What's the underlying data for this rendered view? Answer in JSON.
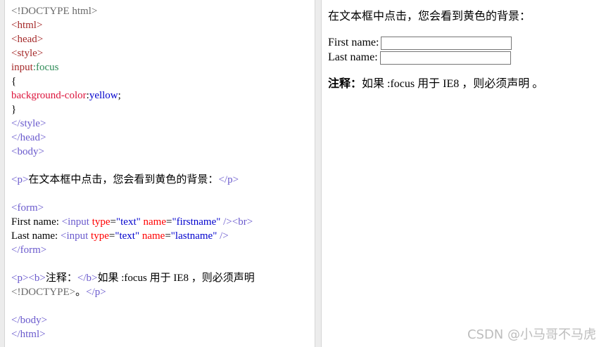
{
  "code_editor": {
    "lines": [
      [
        {
          "t": "<!DOCTYPE html>",
          "c": "c-doc"
        }
      ],
      [
        {
          "t": "<html>",
          "c": "c-tag"
        }
      ],
      [
        {
          "t": "<head>",
          "c": "c-tag"
        }
      ],
      [
        {
          "t": "<style>",
          "c": "c-tag"
        }
      ],
      [
        {
          "t": "input",
          "c": "c-sel"
        },
        {
          "t": ":focus",
          "c": "c-pseudo"
        }
      ],
      [
        {
          "t": "{",
          "c": "c-txt"
        }
      ],
      [
        {
          "t": "background-color",
          "c": "c-prop"
        },
        {
          "t": ":",
          "c": "c-txt"
        },
        {
          "t": "yellow",
          "c": "c-val"
        },
        {
          "t": ";",
          "c": "c-txt"
        }
      ],
      [
        {
          "t": "}",
          "c": "c-txt"
        }
      ],
      [
        {
          "t": "</style>",
          "c": "c-tagbr"
        }
      ],
      [
        {
          "t": "</head>",
          "c": "c-tagbr"
        }
      ],
      [
        {
          "t": "<body>",
          "c": "c-tagbr"
        }
      ],
      [],
      [
        {
          "t": "<p>",
          "c": "c-tagbr"
        },
        {
          "t": "在文本框中点击，您会看到黄色的背景：",
          "c": "c-txt"
        },
        {
          "t": "</p>",
          "c": "c-tagbr"
        }
      ],
      [],
      [
        {
          "t": "<form>",
          "c": "c-tagbr"
        }
      ],
      [
        {
          "t": "First name: ",
          "c": "c-txt"
        },
        {
          "t": "<input ",
          "c": "c-tagbr"
        },
        {
          "t": "type",
          "c": "c-attr"
        },
        {
          "t": "=",
          "c": "c-txt"
        },
        {
          "t": "\"text\" ",
          "c": "c-str"
        },
        {
          "t": "name",
          "c": "c-attr"
        },
        {
          "t": "=",
          "c": "c-txt"
        },
        {
          "t": "\"firstname\" ",
          "c": "c-str"
        },
        {
          "t": "/><br>",
          "c": "c-tagbr"
        }
      ],
      [
        {
          "t": "Last name: ",
          "c": "c-txt"
        },
        {
          "t": "<input ",
          "c": "c-tagbr"
        },
        {
          "t": "type",
          "c": "c-attr"
        },
        {
          "t": "=",
          "c": "c-txt"
        },
        {
          "t": "\"text\" ",
          "c": "c-str"
        },
        {
          "t": "name",
          "c": "c-attr"
        },
        {
          "t": "=",
          "c": "c-txt"
        },
        {
          "t": "\"lastname\" ",
          "c": "c-str"
        },
        {
          "t": "/>",
          "c": "c-tagbr"
        }
      ],
      [
        {
          "t": "</form>",
          "c": "c-tagbr"
        }
      ],
      [],
      [
        {
          "t": "<p><b>",
          "c": "c-tagbr"
        },
        {
          "t": "注释：",
          "c": "c-txt"
        },
        {
          "t": "</b>",
          "c": "c-tagbr"
        },
        {
          "t": "如果 :focus 用于 IE8 ，则必须声明",
          "c": "c-txt"
        }
      ],
      [
        {
          "t": "<!DOCTYPE>",
          "c": "c-doc"
        },
        {
          "t": "。",
          "c": "c-txt"
        },
        {
          "t": "</p>",
          "c": "c-tagbr"
        }
      ],
      [],
      [
        {
          "t": "</body>",
          "c": "c-tagbr"
        }
      ],
      [
        {
          "t": "</html>",
          "c": "c-tagbr"
        }
      ]
    ]
  },
  "preview": {
    "intro_text": "在文本框中点击，您会看到黄色的背景：",
    "first_name_label": "First name:",
    "first_name_value": "",
    "last_name_label": "Last name:",
    "last_name_value": "",
    "note_bold": "注释：",
    "note_text": "如果 :focus 用于 IE8 ，则必须声明 。"
  },
  "watermark": "CSDN @小马哥不马虎",
  "colors": {
    "background": "#ececec",
    "panel": "#ffffff",
    "focus_highlight": "yellow"
  }
}
